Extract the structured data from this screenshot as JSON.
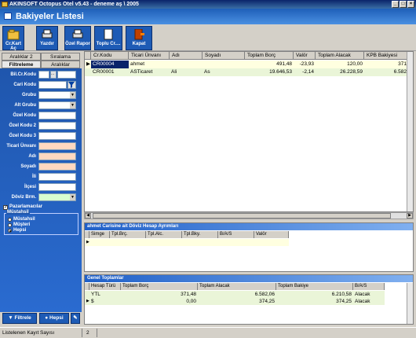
{
  "window": {
    "title": "AKINSOFT Octopus Otel v5.43  -  deneme aş \\ 2005"
  },
  "header": {
    "title": "Bakiyeler Listesi"
  },
  "toolbar": {
    "buttons": [
      {
        "label": "Cr.Kart Aç",
        "icon": "folder-card-icon"
      },
      {
        "label": "Yazdır",
        "icon": "printer-icon"
      },
      {
        "label": "Özel Rapor",
        "icon": "report-printer-icon"
      },
      {
        "label": "Toplu Cr....",
        "icon": "document-icon"
      },
      {
        "label": "Kapat",
        "icon": "exit-door-icon"
      }
    ]
  },
  "leftpanel": {
    "tabs_row1": [
      "Aralıklar 2",
      "Sıralama"
    ],
    "tabs_row2": [
      "Filtreleme",
      "Aralıklar"
    ],
    "fields": [
      {
        "label": "Bil.Cr.Kodu"
      },
      {
        "label": "Cari Kodu"
      },
      {
        "label": "Grubu"
      },
      {
        "label": "Alt Grubu"
      },
      {
        "label": "Özel Kodu"
      },
      {
        "label": "Özel Kodu 2"
      },
      {
        "label": "Özel Kodu 3"
      },
      {
        "label": "Ticari Ünvanı"
      },
      {
        "label": "Adı"
      },
      {
        "label": "Soyadı"
      },
      {
        "label": "İli"
      },
      {
        "label": "İlçesi"
      },
      {
        "label": "Döviz Brm."
      }
    ],
    "checkbox_label": "Pazarlamacılar",
    "group_title": "Müstahsil",
    "radios": [
      "Müstahsil",
      "Müşteri",
      "Hepsi"
    ],
    "filter_button": "Filtrele",
    "all_button": "Hepsi"
  },
  "grid": {
    "columns": [
      "Cr.Kodu",
      "Ticari Ünvanı",
      "Adı",
      "Soyadı",
      "Toplam Borç",
      "Valör",
      "Toplam Alacak",
      "KPB Bakiyesi"
    ],
    "rows": [
      [
        "CR00004",
        "ahmet",
        "",
        "",
        "491,48",
        "-23,93",
        "120,00",
        "371"
      ],
      [
        "CR00001",
        "ASTicaret",
        "Ali",
        "As",
        "19.646,53",
        "-2,14",
        "26.228,59",
        "6.582"
      ]
    ]
  },
  "currency_panel": {
    "title": "ahmet     Carisine ait Döviz Hesap Ayrımları",
    "columns": [
      "Simge",
      "Tpl.Brç.",
      "Tpl.Alc.",
      "Tpl.Bky.",
      "B/A/S",
      "Valör"
    ]
  },
  "totals_panel": {
    "title": "Genel Toplamlar",
    "columns": [
      "Hesap Türü",
      "Toplam Borç",
      "Toplam Alacak",
      "Toplam Bakiye",
      "B/A/S"
    ],
    "rows": [
      [
        "YTL",
        "371,48",
        "6.582,06",
        "6.210,58",
        "Alacak"
      ],
      [
        "$",
        "0,00",
        "374,25",
        "374,25",
        "Alacak"
      ]
    ]
  },
  "status": {
    "label": "Listelenen Kayıt Sayısı",
    "count": "2"
  }
}
